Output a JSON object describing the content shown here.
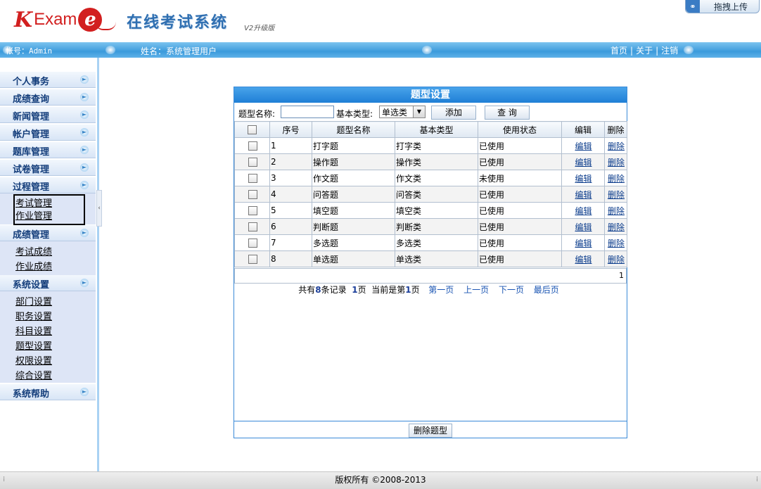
{
  "header": {
    "logo_k": "K",
    "logo_exam": "Exam",
    "logo_e": "e",
    "system_title": "在线考试系统",
    "version": "V2升级版",
    "upload_label": "拖拽上传"
  },
  "infobar": {
    "account": "帐号：Admin",
    "username": "姓名：系统管理用户",
    "links": [
      "首页",
      "关于",
      "注销"
    ],
    "separator": "|"
  },
  "sidebar": {
    "menus": [
      {
        "title": "个人事务"
      },
      {
        "title": "成绩查询"
      },
      {
        "title": "新闻管理"
      },
      {
        "title": "帐户管理"
      },
      {
        "title": "题库管理"
      },
      {
        "title": "试卷管理"
      },
      {
        "title": "过程管理",
        "items": [
          "考试管理",
          "作业管理"
        ]
      },
      {
        "title": "成绩管理",
        "items": [
          "考试成绩",
          "作业成绩"
        ]
      },
      {
        "title": "系统设置",
        "items": [
          "部门设置",
          "职务设置",
          "科目设置",
          "题型设置",
          "权限设置",
          "综合设置"
        ]
      },
      {
        "title": "系统帮助"
      }
    ],
    "collapse_glyph": "‹"
  },
  "panel": {
    "title": "题型设置",
    "filter": {
      "name_label": "题型名称:",
      "name_value": "",
      "type_label": "基本类型:",
      "type_selected": "单选类",
      "add_label": "添加",
      "query_label": "查 询"
    },
    "columns": [
      "",
      "序号",
      "题型名称",
      "基本类型",
      "使用状态",
      "编辑",
      "删除"
    ],
    "rows": [
      {
        "no": "1",
        "name": "打字题",
        "type": "打字类",
        "status": "已使用",
        "edit": "编辑",
        "del": "删除"
      },
      {
        "no": "2",
        "name": "操作题",
        "type": "操作类",
        "status": "已使用",
        "edit": "编辑",
        "del": "删除"
      },
      {
        "no": "3",
        "name": "作文题",
        "type": "作文类",
        "status": "未使用",
        "edit": "编辑",
        "del": "删除"
      },
      {
        "no": "4",
        "name": "问答题",
        "type": "问答类",
        "status": "已使用",
        "edit": "编辑",
        "del": "删除"
      },
      {
        "no": "5",
        "name": "填空题",
        "type": "填空类",
        "status": "已使用",
        "edit": "编辑",
        "del": "删除"
      },
      {
        "no": "6",
        "name": "判断题",
        "type": "判断类",
        "status": "已使用",
        "edit": "编辑",
        "del": "删除"
      },
      {
        "no": "7",
        "name": "多选题",
        "type": "多选类",
        "status": "已使用",
        "edit": "编辑",
        "del": "删除"
      },
      {
        "no": "8",
        "name": "单选题",
        "type": "单选类",
        "status": "已使用",
        "edit": "编辑",
        "del": "删除"
      }
    ],
    "page_number": "1",
    "pager": {
      "total_prefix": "共有",
      "total": "8",
      "total_suffix": "条记录",
      "pages": "1",
      "pages_suffix": "页",
      "current_prefix": "当前是第",
      "current": "1",
      "current_suffix": "页",
      "first": "第一页",
      "prev": "上一页",
      "next": "下一页",
      "last": "最后页"
    },
    "delete_button": "删除题型"
  },
  "footer": {
    "copyright": "版权所有 ©2008-2013"
  },
  "colors": {
    "accent_blue": "#1f7fd6",
    "infobar_blue": "#3c9bdc",
    "logo_red": "#d21f1f",
    "menu_text": "#123c7a"
  }
}
